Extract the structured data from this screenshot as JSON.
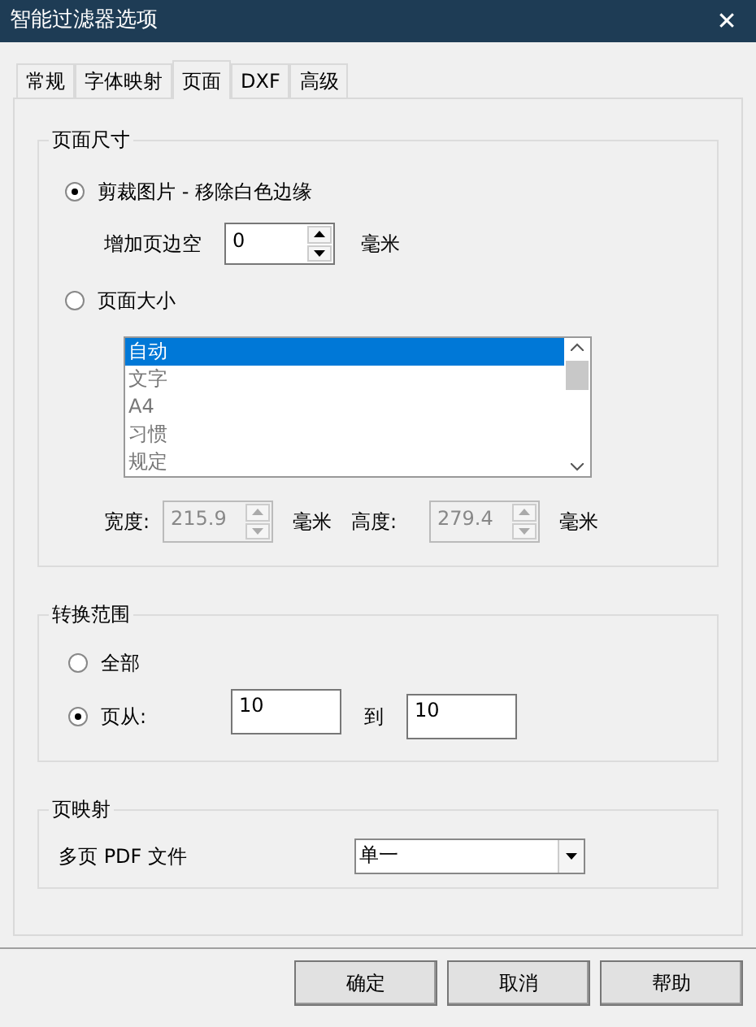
{
  "window": {
    "title": "智能过滤器选项",
    "close": "✕"
  },
  "tabs": [
    {
      "label": "常规",
      "selected": false
    },
    {
      "label": "字体映射",
      "selected": false
    },
    {
      "label": "页面",
      "selected": true
    },
    {
      "label": "DXF",
      "selected": false
    },
    {
      "label": "高级",
      "selected": false
    }
  ],
  "page_size": {
    "title": "页面尺寸",
    "crop": {
      "label": "剪裁图片 - 移除白色边缘",
      "selected": true
    },
    "margin": {
      "label": "增加页边空",
      "value": "0",
      "unit": "毫米"
    },
    "size": {
      "label": "页面大小",
      "selected": false
    },
    "list": [
      {
        "label": "自动",
        "selected": true
      },
      {
        "label": "文字",
        "selected": false
      },
      {
        "label": "A4",
        "selected": false
      },
      {
        "label": "习惯",
        "selected": false
      },
      {
        "label": "规定",
        "selected": false
      }
    ],
    "width": {
      "label": "宽度:",
      "value": "215.9",
      "unit": "毫米",
      "disabled": true
    },
    "height": {
      "label": "高度:",
      "value": "279.4",
      "unit": "毫米",
      "disabled": true
    }
  },
  "range": {
    "title": "转换范围",
    "all": {
      "label": "全部",
      "selected": false
    },
    "pages": {
      "label": "页从:",
      "selected": true,
      "from": "10",
      "to_label": "到",
      "to": "10"
    }
  },
  "mapping": {
    "title": "页映射",
    "label": "多页 PDF 文件",
    "value": "单一"
  },
  "buttons": [
    "确定",
    "取消",
    "帮助"
  ]
}
